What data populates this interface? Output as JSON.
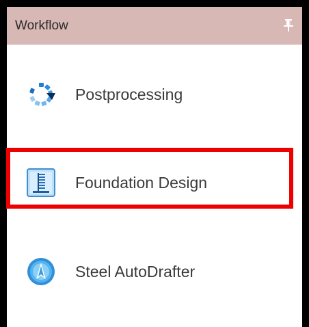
{
  "panel": {
    "title": "Workflow",
    "pin_icon": "pin-icon",
    "header_color": "#d8b8b4"
  },
  "items": [
    {
      "label": "Postprocessing",
      "icon": "postprocessing-icon"
    },
    {
      "label": "Foundation Design",
      "icon": "foundation-design-icon",
      "highlighted": true
    },
    {
      "label": "Steel AutoDrafter",
      "icon": "steel-autodrafter-icon"
    }
  ],
  "highlight_color": "#ee0000"
}
